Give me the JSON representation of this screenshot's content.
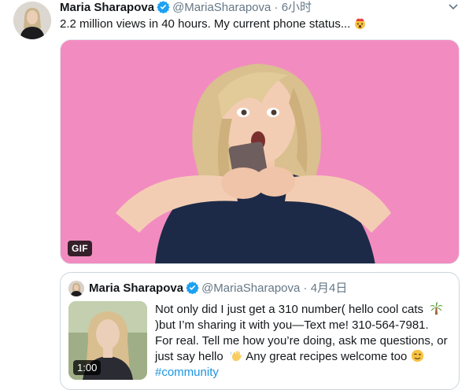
{
  "tweet": {
    "name": "Maria Sharapova",
    "handle": "@MariaSharapova",
    "separator": "·",
    "time": "6小时",
    "text": "2.2 million views in 40 hours. My current phone status..."
  },
  "media": {
    "badge": "GIF",
    "background_color": "#f28cc0"
  },
  "quote": {
    "name": "Maria Sharapova",
    "handle": "@MariaSharapova",
    "separator": "·",
    "time": "4月4日",
    "video_duration": "1:00",
    "text_part1": "Not only did I just get a 310 number( hello cool cats ",
    "text_part2": ")but I’m sharing it with you—Text me! 310-564-7981. For real. Tell me how you’re doing, ask me questions, or just say hello ",
    "text_part3": " Any great recipes welcome too ",
    "hashtag": "#community"
  },
  "colors": {
    "verified": "#1da1f2",
    "link": "#1b95e0",
    "secondary_text": "#657786"
  },
  "icons": {
    "verified": "verified-badge-icon",
    "caret": "chevron-down-icon",
    "emoji_exploding_head": "exploding-head-emoji-icon",
    "emoji_palm_tree": "palm-tree-emoji-icon",
    "emoji_waving_hand": "waving-hand-emoji-icon",
    "emoji_winking": "winking-face-emoji-icon"
  }
}
